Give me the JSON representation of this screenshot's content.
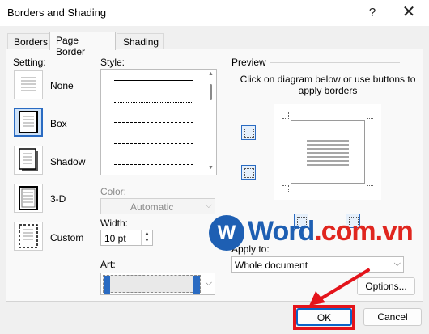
{
  "window": {
    "title": "Borders and Shading",
    "help_label": "?",
    "close_label": "✕"
  },
  "tabs": [
    {
      "label": "Borders",
      "active": false
    },
    {
      "label": "Page Border",
      "active": true
    },
    {
      "label": "Shading",
      "active": false
    }
  ],
  "setting": {
    "heading": "Setting:",
    "options": [
      {
        "label": "None",
        "icon": "setting-none-icon",
        "selected": false
      },
      {
        "label": "Box",
        "icon": "setting-box-icon",
        "selected": true
      },
      {
        "label": "Shadow",
        "icon": "setting-shadow-icon",
        "selected": false
      },
      {
        "label": "3-D",
        "icon": "setting-3d-icon",
        "selected": false
      },
      {
        "label": "Custom",
        "icon": "setting-custom-icon",
        "selected": false
      }
    ]
  },
  "style": {
    "heading": "Style:"
  },
  "color": {
    "heading": "Color:",
    "value": "Automatic",
    "disabled": true
  },
  "width": {
    "heading": "Width:",
    "value": "10 pt"
  },
  "art": {
    "heading": "Art:",
    "accent": "#2a6bc2"
  },
  "preview": {
    "heading": "Preview",
    "instructions": "Click on diagram below or use buttons to apply borders"
  },
  "apply_to": {
    "heading": "Apply to:",
    "value": "Whole document"
  },
  "buttons": {
    "options": "Options...",
    "ok": "OK",
    "cancel": "Cancel"
  },
  "watermark": {
    "logo_letter": "W",
    "brand_a": "Word",
    "brand_b": ".com.vn"
  },
  "colors": {
    "accent": "#2a6bc2",
    "highlight": "#e4141b"
  }
}
